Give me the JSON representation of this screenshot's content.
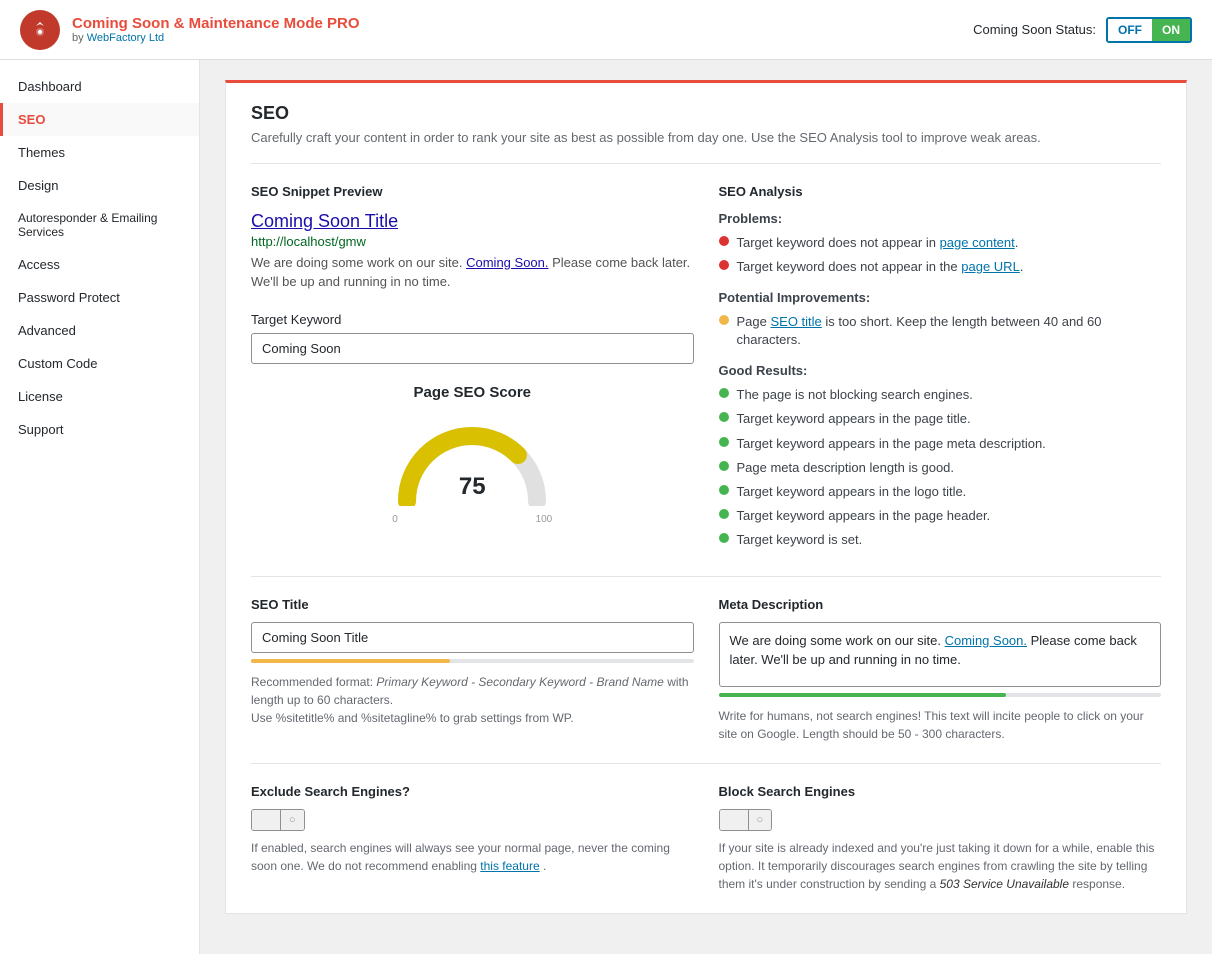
{
  "header": {
    "logo_icon": "W",
    "app_name": "Coming Soon & Maintenance Mode",
    "app_name_pro": "PRO",
    "by_text": "by",
    "company_link": "WebFactory Ltd",
    "status_label": "Coming Soon Status:",
    "toggle_off": "OFF",
    "toggle_on": "ON"
  },
  "sidebar": {
    "items": [
      {
        "id": "dashboard",
        "label": "Dashboard",
        "active": false
      },
      {
        "id": "seo",
        "label": "SEO",
        "active": true
      },
      {
        "id": "themes",
        "label": "Themes",
        "active": false
      },
      {
        "id": "design",
        "label": "Design",
        "active": false
      },
      {
        "id": "autoresponder",
        "label": "Autoresponder & Emailing Services",
        "active": false
      },
      {
        "id": "access",
        "label": "Access",
        "active": false
      },
      {
        "id": "password-protect",
        "label": "Password Protect",
        "active": false
      },
      {
        "id": "advanced",
        "label": "Advanced",
        "active": false
      },
      {
        "id": "custom-code",
        "label": "Custom Code",
        "active": false
      },
      {
        "id": "license",
        "label": "License",
        "active": false
      },
      {
        "id": "support",
        "label": "Support",
        "active": false
      }
    ]
  },
  "page": {
    "title": "SEO",
    "description": "Carefully craft your content in order to rank your site as best as possible from day one. Use the SEO Analysis tool to improve weak areas."
  },
  "seo_snippet": {
    "section_title": "SEO Snippet Preview",
    "title": "Coming Soon Title",
    "url": "http://localhost/gmw",
    "description_part1": "We are doing some work on our site.",
    "description_highlight": "Coming Soon.",
    "description_part2": "Please come back later. We'll be up and running in no time."
  },
  "target_keyword": {
    "label": "Target Keyword",
    "value": "Coming Soon",
    "placeholder": "Coming Soon"
  },
  "score": {
    "title": "Page SEO Score",
    "value": "75",
    "min": "0",
    "max": "100"
  },
  "seo_analysis": {
    "section_title": "SEO Analysis",
    "problems_label": "Problems:",
    "problems": [
      {
        "text_before": "Target keyword does not appear in ",
        "link": "page content",
        "text_after": ".",
        "type": "red"
      },
      {
        "text_before": "Target keyword does not appear in the ",
        "link": "page URL",
        "text_after": ".",
        "type": "red"
      }
    ],
    "improvements_label": "Potential Improvements:",
    "improvements": [
      {
        "text_before": "Page ",
        "link": "SEO title",
        "text_after": " is too short. Keep the length between 40 and 60 characters.",
        "type": "yellow"
      }
    ],
    "good_label": "Good Results:",
    "good": [
      {
        "text": "The page is not blocking search engines.",
        "type": "green"
      },
      {
        "text": "Target keyword appears in the page title.",
        "type": "green"
      },
      {
        "text": "Target keyword appears in the page meta description.",
        "type": "green"
      },
      {
        "text": "Page meta description length is good.",
        "type": "green"
      },
      {
        "text": "Target keyword appears in the logo title.",
        "type": "green"
      },
      {
        "text": "Target keyword appears in the page header.",
        "type": "green"
      },
      {
        "text": "Target keyword is set.",
        "type": "green"
      }
    ]
  },
  "seo_title": {
    "section_title": "SEO Title",
    "value": "Coming Soon Title",
    "placeholder": "Coming Soon Title",
    "hint_intro": "Recommended format:",
    "hint_format": "Primary Keyword - Secondary Keyword - Brand Name",
    "hint_length": "with length up to 60 characters.",
    "hint_vars": "Use %sitetitle% and %sitetagline% to grab settings from WP."
  },
  "meta_description": {
    "section_title": "Meta Description",
    "value_part1": "We are doing some work on our site.",
    "value_highlight": "Coming Soon.",
    "value_part2": "Please come back later. We'll be up and running in no time.",
    "hint": "Write for humans, not search engines! This text will incite people to click on your site on Google. Length should be 50 - 300 characters."
  },
  "exclude_engines": {
    "section_title": "Exclude Search Engines?",
    "toggle_left": "",
    "toggle_right": "○",
    "desc_part1": "If enabled, search engines will always see your normal page, never the coming soon one. We do not recommend enabling",
    "desc_highlight": "this feature",
    "desc_part2": "."
  },
  "block_engines": {
    "section_title": "Block Search Engines",
    "toggle_left": "",
    "toggle_right": "○",
    "desc": "If your site is already indexed and you're just taking it down for a while, enable this option. It temporarily discourages search engines from crawling the site by telling them it's under construction by sending a",
    "desc_highlight": "503 Service Unavailable",
    "desc_part2": "response."
  }
}
